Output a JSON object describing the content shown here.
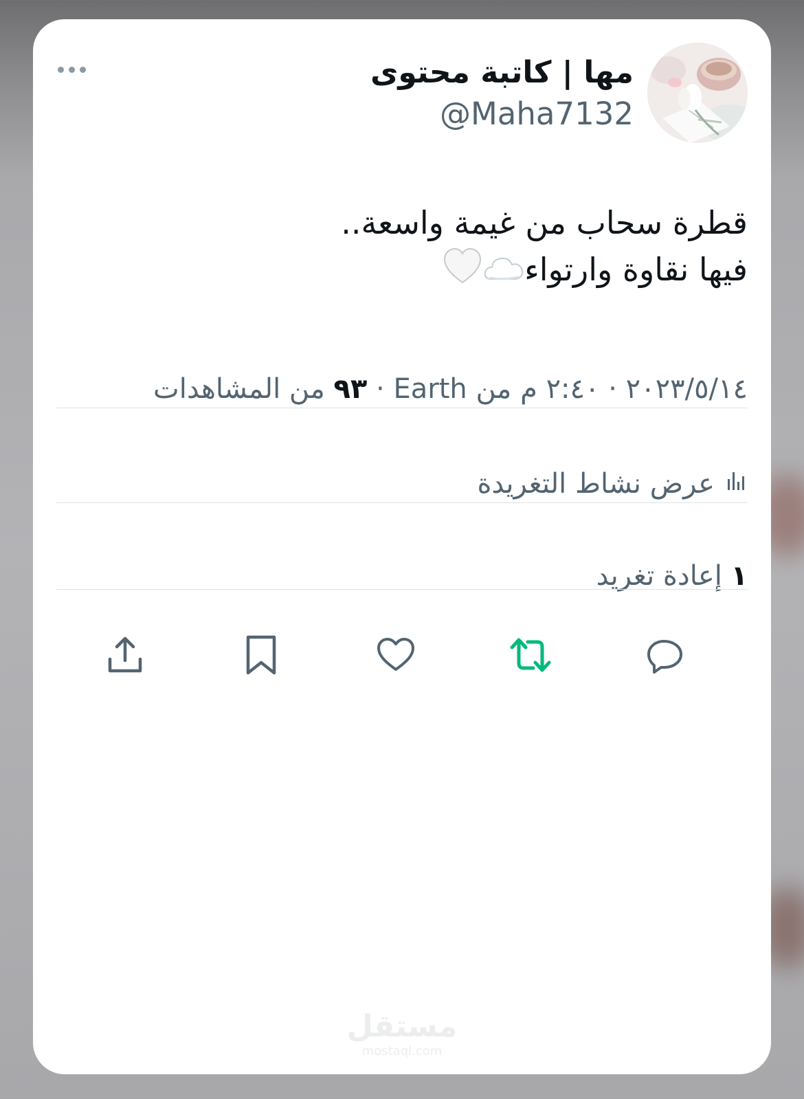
{
  "profile": {
    "display_name": "مها | كاتبة محتوى",
    "handle": "@Maha7132"
  },
  "tweet": {
    "line1": "قطرة سحاب من غيمة واسعة..",
    "line2": "فيها نقاوة وارتواء",
    "emoji_icons": [
      "cloud-icon",
      "white-heart-icon"
    ]
  },
  "meta": {
    "time": "٢:٤٠ م",
    "date": "٢٠٢٣/٥/١٤",
    "source": "من Earth",
    "views_count": "٩٣",
    "views_label": "من المشاهدات"
  },
  "activity": {
    "label": "عرض نشاط التغريدة",
    "icon": "bar-chart-icon"
  },
  "retweets": {
    "count": "١",
    "label": "إعادة تغريد"
  },
  "actions": [
    "reply-icon",
    "retweet-icon",
    "like-icon",
    "bookmark-icon",
    "share-icon"
  ],
  "colors": {
    "text_primary": "#0f1419",
    "text_secondary": "#536471",
    "retweet_active": "#00ba7c",
    "divider": "#dfe3e6"
  },
  "watermark": {
    "arabic": "مستقل",
    "latin": "mostaql.com"
  }
}
